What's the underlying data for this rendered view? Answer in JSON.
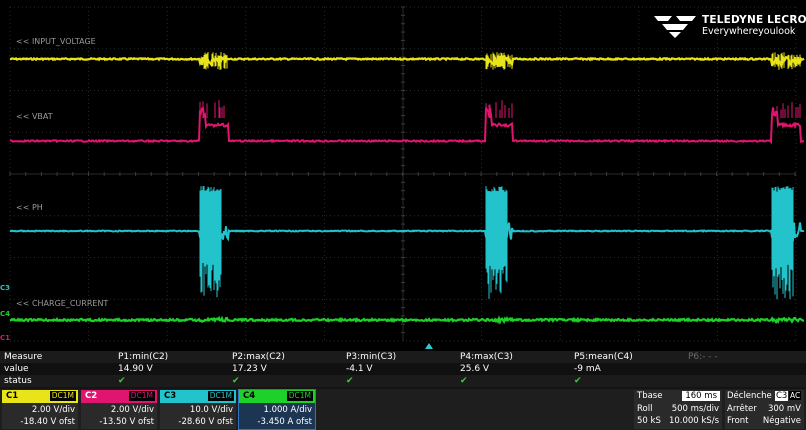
{
  "brand": {
    "name": "TELEDYNE LECROY",
    "tagline": "Everywhereyoulook"
  },
  "traces": [
    {
      "id": "C1",
      "label": "<< INPUT_VOLTAGE",
      "color": "#e9e41a"
    },
    {
      "id": "C2",
      "label": "<< VBAT",
      "color": "#e0156f"
    },
    {
      "id": "C3",
      "label": "<< PH",
      "color": "#23c3cb"
    },
    {
      "id": "C4",
      "label": "<< CHARGE_CURRENT",
      "color": "#1ed02a"
    }
  ],
  "markers": {
    "c3": "C3",
    "c4": "C4",
    "c1": "C1"
  },
  "measure": {
    "row_labels": [
      "Measure",
      "value",
      "status"
    ],
    "columns": [
      {
        "name": "P1:min(C2)",
        "value": "14.90 V",
        "status": "✔"
      },
      {
        "name": "P2:max(C2)",
        "value": "17.23 V",
        "status": "✔"
      },
      {
        "name": "P3:min(C3)",
        "value": "-4.1 V",
        "status": "✔"
      },
      {
        "name": "P4:max(C3)",
        "value": "25.6 V",
        "status": "✔"
      },
      {
        "name": "P5:mean(C4)",
        "value": "-9 mA",
        "status": "✔"
      },
      {
        "name": "P6:- - -",
        "value": "",
        "status": ""
      }
    ]
  },
  "channels": [
    {
      "name": "C1",
      "coupling": "DC1M",
      "vdiv": "2.00 V/div",
      "offset": "-18.40 V ofst",
      "color": "#e9e41a"
    },
    {
      "name": "C2",
      "coupling": "DC1M",
      "vdiv": "2.00 V/div",
      "offset": "-13.50 V ofst",
      "color": "#e0156f"
    },
    {
      "name": "C3",
      "coupling": "DC1M",
      "vdiv": "10.0 V/div",
      "offset": "-28.60 V ofst",
      "color": "#23c3cb"
    },
    {
      "name": "C4",
      "coupling": "DC1M",
      "vdiv": "1.000 A/div",
      "offset": "-3.450 A ofst",
      "color": "#1ed02a"
    }
  ],
  "timebase": {
    "label": "Tbase",
    "value": "160 ms",
    "mode": "Roll",
    "div": "500 ms/div",
    "samples": "50 kS",
    "rate": "10.000 kS/s"
  },
  "trigger": {
    "label": "Déclenche",
    "source": "C3",
    "coupling": "AC",
    "mode": "Arrêter",
    "level": "300 mV",
    "type": "Front",
    "slope": "Négative"
  }
}
